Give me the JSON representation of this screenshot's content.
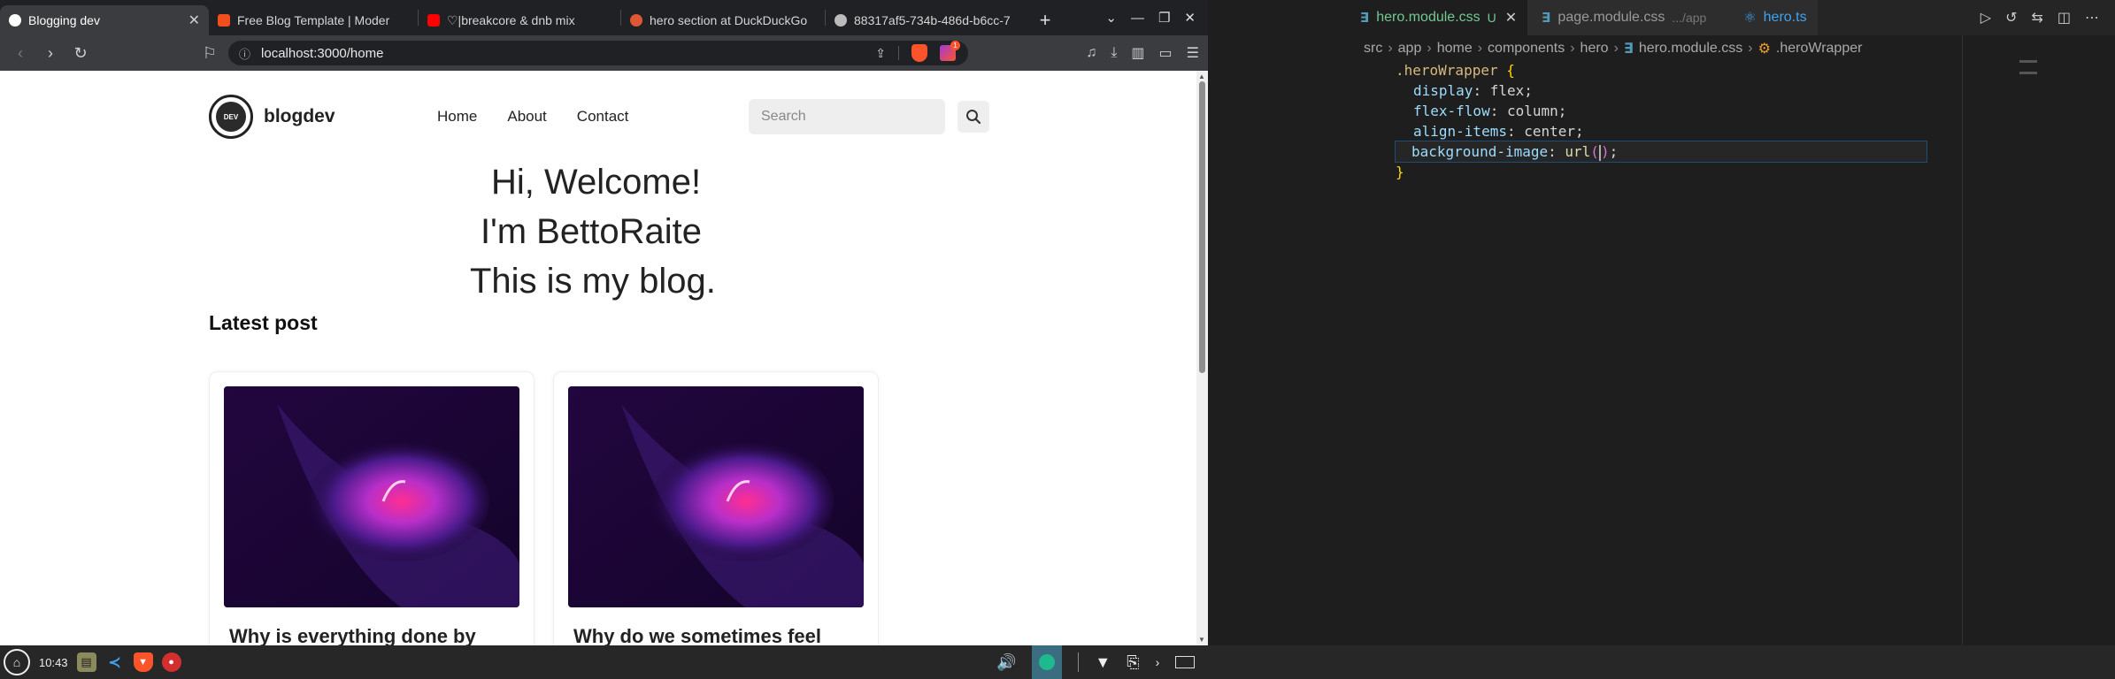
{
  "browser": {
    "tabs": [
      {
        "title": "Blogging dev",
        "active": true,
        "icon": "brave-icon",
        "color": "#ffffff"
      },
      {
        "title": "Free Blog Template | Moder",
        "active": false,
        "icon": "figma-icon",
        "color": "#f24e1e"
      },
      {
        "title": "♡|breakcore & dnb mix",
        "active": false,
        "icon": "youtube-icon",
        "color": "#ff0000"
      },
      {
        "title": "hero section at DuckDuckGo",
        "active": false,
        "icon": "duckduckgo-icon",
        "color": "#de5833"
      },
      {
        "title": "88317af5-734b-486d-b6cc-7",
        "active": false,
        "icon": "globe-icon",
        "color": "#bbbbbb"
      }
    ],
    "url": "localhost:3000/home"
  },
  "site": {
    "brand": "blogdev",
    "logo_text": "DEV",
    "nav": [
      "Home",
      "About",
      "Contact"
    ],
    "search_placeholder": "Search",
    "hero_lines": [
      "Hi, Welcome!",
      "I'm BettoRaite",
      "This is my blog."
    ],
    "section_title": "Latest post",
    "cards": [
      {
        "title": "Why is everything done by"
      },
      {
        "title": "Why do we sometimes feel"
      }
    ]
  },
  "vscode": {
    "tabs": [
      {
        "name": "hero.module.css",
        "status": "U",
        "active": true
      },
      {
        "name": "page.module.css",
        "sub": ".../app",
        "active": false
      },
      {
        "name": "hero.ts",
        "active": false
      }
    ],
    "breadcrumb": [
      "src",
      "app",
      "home",
      "components",
      "hero",
      "hero.module.css",
      ".heroWrapper"
    ],
    "code": {
      "selector": ".heroWrapper",
      "props": [
        {
          "name": "display",
          "value": "flex"
        },
        {
          "name": "flex-flow",
          "value": "column"
        },
        {
          "name": "align-items",
          "value": "center"
        }
      ],
      "bg_prop": "background-image",
      "bg_fn": "url"
    }
  },
  "taskbar": {
    "time": "10:43"
  }
}
